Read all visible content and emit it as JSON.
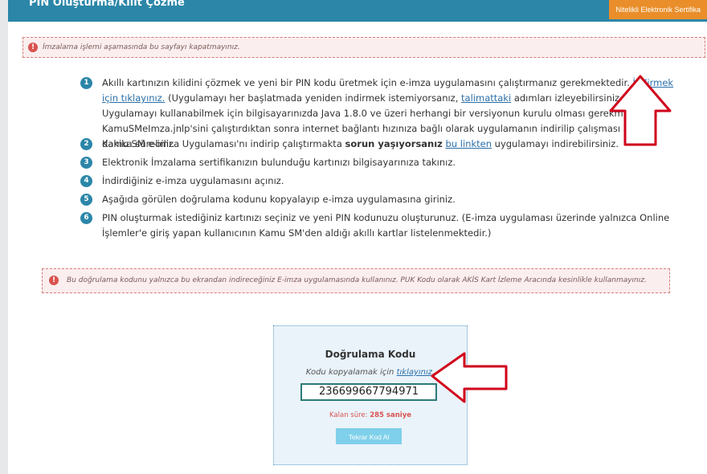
{
  "header": {
    "title": "PIN Oluşturma/Kilit Çözme",
    "button_label": "Nitelikli Elektronik Sertifika"
  },
  "warning_top": {
    "icon": "!",
    "text": "İmzalama işlemi aşamasında bu sayfayı kapatmayınız."
  },
  "steps": [
    {
      "num": "1",
      "text_a": "Akıllı kartınızın kilidini çözmek ve yeni bir PIN kodu üretmek için e-imza uygulamasını çalıştırmanız gerekmektedir. ",
      "link_a": "İndirmek için tıklayınız.",
      "text_b": " (Uygulamayı her başlatmada yeniden indirmek istemiyorsanız, ",
      "link_b": "talimattaki",
      "text_c": " adımları izleyebilirsiniz.) Uygulamayı kullanabilmek için bilgisayarınızda Java 1.8.0 ve üzeri herhangi bir versiyonun kurulu olması gerekmektedir. KamuSMeImza.jnlp'sini çalıştırdıktan sonra internet bağlantı hızınıza bağlı olarak uygulamanın indirilip çalışması birkaç dakika sürebilir."
    },
    {
      "num": "2",
      "text_a": "Kamu SM e-imza Uygulaması'nı indirip çalıştırmakta ",
      "bold": "sorun yaşıyorsanız",
      "text_b": " ",
      "link": "bu linkten",
      "text_c": " uygulamayı indirebilirsiniz."
    },
    {
      "num": "3",
      "text": "Elektronik İmzalama sertifikanızın bulunduğu kartınızı bilgisayarınıza takınız."
    },
    {
      "num": "4",
      "text": "İndirdiğiniz e-imza uygulamasını açınız."
    },
    {
      "num": "5",
      "text": "Aşağıda görülen doğrulama kodunu kopyalayıp e-imza uygulamasına giriniz."
    },
    {
      "num": "6",
      "text": "PIN oluşturmak istediğiniz kartınızı seçiniz ve yeni PIN kodunuzu oluşturunuz. (E-imza uygulaması üzerinde yalnızca Online İşlemler'e giriş yapan kullanıcının Kamu SM'den aldığı akıllı kartlar listelenmektedir.)"
    }
  ],
  "warning_bottom": {
    "icon": "!",
    "text": "Bu doğrulama kodunu yalnızca bu ekrandan indireceğiniz E-imza uygulamasında kullanınız. PUK Kodu olarak AKİS Kart İzleme Aracında kesinlikle kullanmayınız."
  },
  "verification": {
    "title": "Doğrulama Kodu",
    "copy_prefix": "Kodu kopyalamak için ",
    "copy_link": "tıklayınız.",
    "code": "236699667794971",
    "time_label": "Kalan süre: ",
    "time_value": "285",
    "time_unit": " saniye",
    "button_label": "Tekrar Kod Al"
  },
  "colors": {
    "header": "#2b86a8",
    "step_badge": "#2b86a8",
    "warning_icon": "#d9534f",
    "annotation_arrow": "#d0021b",
    "orange_button": "#e98e2a"
  }
}
